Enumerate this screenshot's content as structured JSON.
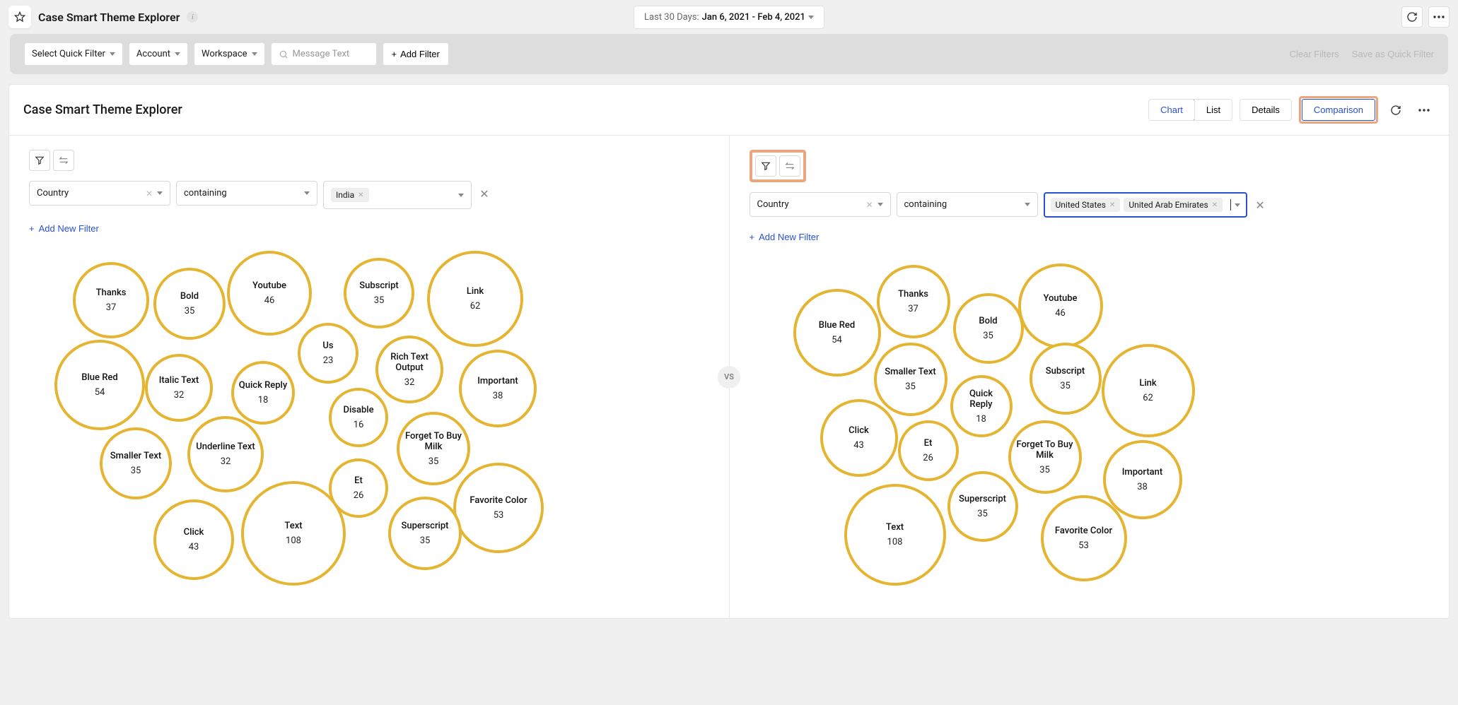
{
  "header": {
    "page_title": "Case Smart Theme Explorer",
    "date_label": "Last 30 Days:",
    "date_value": "Jan 6, 2021 - Feb 4, 2021"
  },
  "filter_bar": {
    "quick_filter": "Select Quick Filter",
    "account": "Account",
    "workspace": "Workspace",
    "search_placeholder": "Message Text",
    "add_filter": "Add Filter",
    "clear_filters": "Clear Filters",
    "save_quick_filter": "Save as Quick Filter"
  },
  "card": {
    "title": "Case Smart Theme Explorer",
    "tabs_view": {
      "chart": "Chart",
      "list": "List"
    },
    "tabs_mode": {
      "details": "Details",
      "comparison": "Comparison"
    }
  },
  "vs_label": "VS",
  "left_panel": {
    "field": "Country",
    "op": "containing",
    "values": [
      "India"
    ],
    "add_new_filter": "Add New Filter",
    "bubbles": [
      {
        "label": "Thanks",
        "value": 37,
        "x": 62,
        "y": 28,
        "d": 108
      },
      {
        "label": "Bold",
        "value": 35,
        "x": 176,
        "y": 36,
        "d": 102
      },
      {
        "label": "Youtube",
        "value": 46,
        "x": 280,
        "y": 12,
        "d": 120
      },
      {
        "label": "Subscript",
        "value": 35,
        "x": 445,
        "y": 22,
        "d": 100
      },
      {
        "label": "Link",
        "value": 62,
        "x": 563,
        "y": 12,
        "d": 136
      },
      {
        "label": "Blue Red",
        "value": 54,
        "x": 36,
        "y": 138,
        "d": 128
      },
      {
        "label": "Italic Text",
        "value": 32,
        "x": 164,
        "y": 158,
        "d": 96
      },
      {
        "label": "Us",
        "value": 23,
        "x": 380,
        "y": 114,
        "d": 86
      },
      {
        "label": "Rich Text Output",
        "value": 32,
        "x": 490,
        "y": 132,
        "d": 96
      },
      {
        "label": "Quick Reply",
        "value": 18,
        "x": 286,
        "y": 168,
        "d": 90
      },
      {
        "label": "Important",
        "value": 38,
        "x": 608,
        "y": 152,
        "d": 110
      },
      {
        "label": "Disable",
        "value": 16,
        "x": 424,
        "y": 206,
        "d": 84
      },
      {
        "label": "Smaller Text",
        "value": 35,
        "x": 100,
        "y": 262,
        "d": 102
      },
      {
        "label": "Underline Text",
        "value": 32,
        "x": 224,
        "y": 246,
        "d": 108
      },
      {
        "label": "Forget To Buy Milk",
        "value": 35,
        "x": 520,
        "y": 240,
        "d": 104
      },
      {
        "label": "Favorite Color",
        "value": 53,
        "x": 600,
        "y": 312,
        "d": 128
      },
      {
        "label": "Click",
        "value": 43,
        "x": 176,
        "y": 364,
        "d": 114
      },
      {
        "label": "Text",
        "value": 108,
        "x": 300,
        "y": 338,
        "d": 148
      },
      {
        "label": "Et",
        "value": 26,
        "x": 424,
        "y": 306,
        "d": 84
      },
      {
        "label": "Superscript",
        "value": 35,
        "x": 508,
        "y": 360,
        "d": 104
      }
    ]
  },
  "right_panel": {
    "field": "Country",
    "op": "containing",
    "values": [
      "United States",
      "United Arab Emirates"
    ],
    "add_new_filter": "Add New Filter",
    "bubbles": [
      {
        "label": "Thanks",
        "value": 37,
        "x": 180,
        "y": 20,
        "d": 104
      },
      {
        "label": "Youtube",
        "value": 46,
        "x": 380,
        "y": 18,
        "d": 120
      },
      {
        "label": "Blue Red",
        "value": 54,
        "x": 62,
        "y": 54,
        "d": 124
      },
      {
        "label": "Bold",
        "value": 35,
        "x": 288,
        "y": 60,
        "d": 100
      },
      {
        "label": "Smaller Text",
        "value": 35,
        "x": 176,
        "y": 130,
        "d": 104
      },
      {
        "label": "Quick Reply",
        "value": 18,
        "x": 284,
        "y": 176,
        "d": 88
      },
      {
        "label": "Subscript",
        "value": 35,
        "x": 396,
        "y": 130,
        "d": 102
      },
      {
        "label": "Link",
        "value": 62,
        "x": 498,
        "y": 132,
        "d": 132
      },
      {
        "label": "Click",
        "value": 43,
        "x": 100,
        "y": 210,
        "d": 110
      },
      {
        "label": "Et",
        "value": 26,
        "x": 210,
        "y": 240,
        "d": 86
      },
      {
        "label": "Forget To Buy Milk",
        "value": 35,
        "x": 366,
        "y": 240,
        "d": 104
      },
      {
        "label": "Important",
        "value": 38,
        "x": 500,
        "y": 268,
        "d": 112
      },
      {
        "label": "Superscript",
        "value": 35,
        "x": 280,
        "y": 312,
        "d": 100
      },
      {
        "label": "Text",
        "value": 108,
        "x": 134,
        "y": 330,
        "d": 144
      },
      {
        "label": "Favorite Color",
        "value": 53,
        "x": 412,
        "y": 346,
        "d": 122
      }
    ]
  },
  "chart_data": [
    {
      "type": "bubble",
      "title": "Left — India",
      "series": [
        {
          "name": "Thanks",
          "value": 37
        },
        {
          "name": "Bold",
          "value": 35
        },
        {
          "name": "Youtube",
          "value": 46
        },
        {
          "name": "Subscript",
          "value": 35
        },
        {
          "name": "Link",
          "value": 62
        },
        {
          "name": "Blue Red",
          "value": 54
        },
        {
          "name": "Italic Text",
          "value": 32
        },
        {
          "name": "Us",
          "value": 23
        },
        {
          "name": "Rich Text Output",
          "value": 32
        },
        {
          "name": "Quick Reply",
          "value": 18
        },
        {
          "name": "Important",
          "value": 38
        },
        {
          "name": "Disable",
          "value": 16
        },
        {
          "name": "Smaller Text",
          "value": 35
        },
        {
          "name": "Underline Text",
          "value": 32
        },
        {
          "name": "Forget To Buy Milk",
          "value": 35
        },
        {
          "name": "Favorite Color",
          "value": 53
        },
        {
          "name": "Click",
          "value": 43
        },
        {
          "name": "Text",
          "value": 108
        },
        {
          "name": "Et",
          "value": 26
        },
        {
          "name": "Superscript",
          "value": 35
        }
      ]
    },
    {
      "type": "bubble",
      "title": "Right — United States, United Arab Emirates",
      "series": [
        {
          "name": "Thanks",
          "value": 37
        },
        {
          "name": "Youtube",
          "value": 46
        },
        {
          "name": "Blue Red",
          "value": 54
        },
        {
          "name": "Bold",
          "value": 35
        },
        {
          "name": "Smaller Text",
          "value": 35
        },
        {
          "name": "Quick Reply",
          "value": 18
        },
        {
          "name": "Subscript",
          "value": 35
        },
        {
          "name": "Link",
          "value": 62
        },
        {
          "name": "Click",
          "value": 43
        },
        {
          "name": "Et",
          "value": 26
        },
        {
          "name": "Forget To Buy Milk",
          "value": 35
        },
        {
          "name": "Important",
          "value": 38
        },
        {
          "name": "Superscript",
          "value": 35
        },
        {
          "name": "Text",
          "value": 108
        },
        {
          "name": "Favorite Color",
          "value": 53
        }
      ]
    }
  ]
}
